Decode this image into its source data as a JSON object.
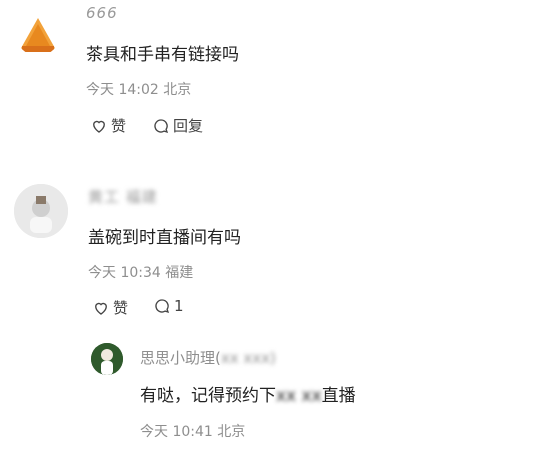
{
  "comments": [
    {
      "username": "666",
      "text": "茶具和手串有链接吗",
      "meta": "今天 14:02 北京",
      "like_label": "赞",
      "reply_label": "回复"
    },
    {
      "username": "黄工 福建",
      "text": "盖碗到时直播间有吗",
      "meta": "今天 10:34 福建",
      "like_label": "赞",
      "reply_count": "1",
      "reply": {
        "username": "思思小助理(",
        "username_blurred": "xx xxx)",
        "text_before": "有哒，记得预约下",
        "text_blurred": "xx xx",
        "text_after": "直播",
        "meta": "今天 10:41 北京"
      }
    }
  ],
  "icons": {
    "like": "heart-outline-icon",
    "reply": "speech-bubble-icon"
  },
  "colors": {
    "text": "#222222",
    "meta": "#8e8e8e",
    "username": "#9a9a9a"
  }
}
